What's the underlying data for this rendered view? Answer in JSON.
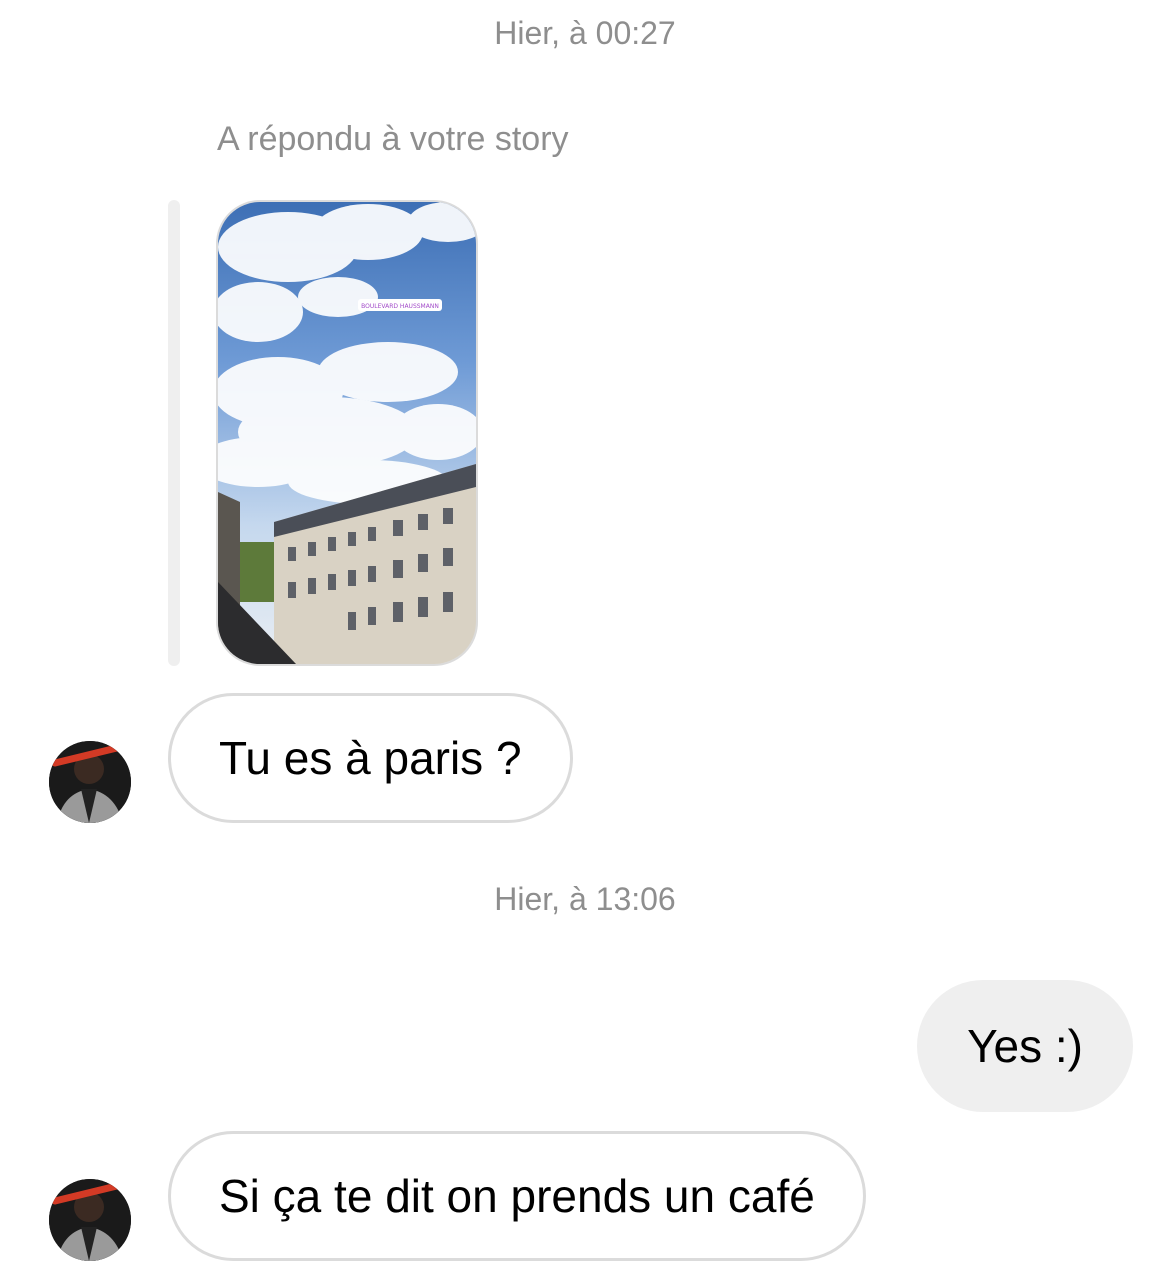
{
  "thread": {
    "timestamps": [
      "Hier, à 00:27",
      "Hier, à 13:06"
    ],
    "story_reply": {
      "caption": "A répondu à votre story",
      "location_sticker": "BOULEVARD HAUSSMANN"
    },
    "messages": [
      {
        "from": "them",
        "text": "Tu es à paris ?"
      },
      {
        "from": "me",
        "text": "Yes :)"
      },
      {
        "from": "them",
        "text": "Si ça te dit on prends un café"
      }
    ]
  }
}
